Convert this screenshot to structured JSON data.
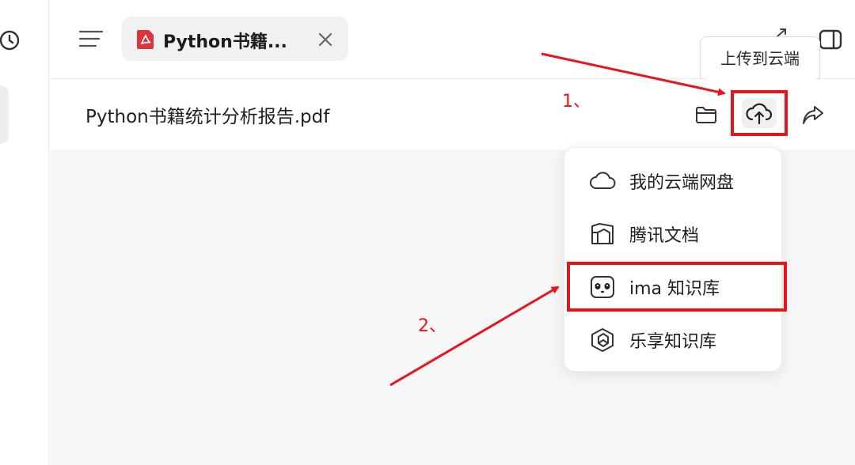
{
  "tab": {
    "title": "Python书籍..."
  },
  "tooltip": {
    "text": "上传到云端"
  },
  "document": {
    "title": "Python书籍统计分析报告.pdf"
  },
  "upload_menu": {
    "items": [
      {
        "label": "我的云端网盘",
        "icon": "cloud-icon"
      },
      {
        "label": "腾讯文档",
        "icon": "tencent-docs-icon"
      },
      {
        "label": "ima 知识库",
        "icon": "panda-icon"
      },
      {
        "label": "乐享知识库",
        "icon": "hexagon-logo-icon"
      }
    ]
  },
  "annotations": {
    "step1": "1、",
    "step2": "2、"
  },
  "colors": {
    "annotation_red": "#e8141c",
    "pdf_red": "#d9363e",
    "content_bg": "#f7f7f7"
  }
}
